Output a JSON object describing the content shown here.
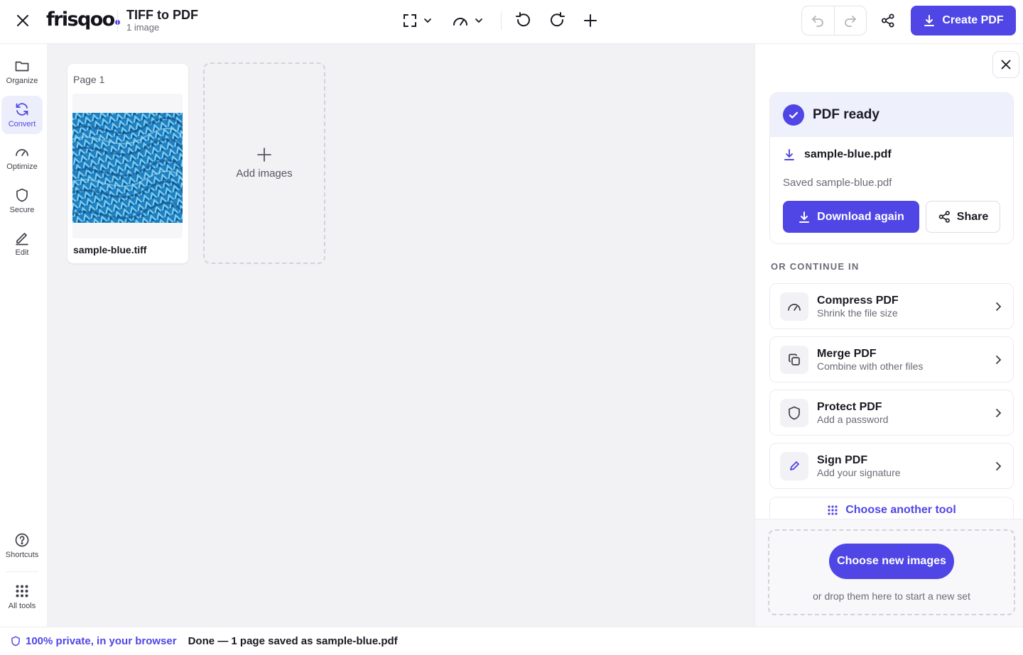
{
  "app": {
    "logo_text": "frisqoo",
    "title": "TIFF to PDF",
    "subtitle": "1 image"
  },
  "toolbar": {
    "create_label": "Create PDF"
  },
  "rail": {
    "items": [
      {
        "label": "Organize",
        "icon": "folder-icon"
      },
      {
        "label": "Convert",
        "icon": "refresh-icon",
        "active": true
      },
      {
        "label": "Optimize",
        "icon": "gauge-icon"
      },
      {
        "label": "Secure",
        "icon": "shield-icon"
      },
      {
        "label": "Edit",
        "icon": "pencil-icon"
      }
    ],
    "bottom": [
      {
        "label": "Shortcuts",
        "icon": "question-icon"
      },
      {
        "label": "All tools",
        "icon": "grid-icon"
      }
    ]
  },
  "canvas": {
    "pages": [
      {
        "label": "Page 1",
        "file_name": "sample-blue.tiff"
      }
    ],
    "add_label": "Add images"
  },
  "panel": {
    "ready_title": "PDF ready",
    "file_name": "sample-blue.pdf",
    "saved_text": "Saved sample-blue.pdf",
    "download_label": "Download again",
    "share_label": "Share",
    "continue_heading": "OR CONTINUE IN",
    "tools": [
      {
        "name": "Compress PDF",
        "desc": "Shrink the file size",
        "icon": "gauge-icon"
      },
      {
        "name": "Merge PDF",
        "desc": "Combine with other files",
        "icon": "copy-icon"
      },
      {
        "name": "Protect PDF",
        "desc": "Add a password",
        "icon": "shield-icon"
      },
      {
        "name": "Sign PDF",
        "desc": "Add your signature",
        "icon": "pen-icon"
      }
    ],
    "another_tool": "Choose another tool",
    "choose_new": "Choose new images",
    "drop_hint": "or drop them here to start a new set"
  },
  "status": {
    "private": "100% private, in your browser",
    "message": "Done — 1 page saved as sample-blue.pdf"
  },
  "colors": {
    "accent": "#4f46e5",
    "canvas_bg": "#f2f2f5"
  }
}
